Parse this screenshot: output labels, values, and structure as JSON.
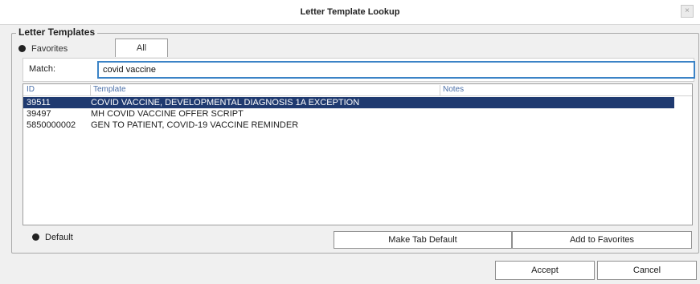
{
  "window": {
    "title": "Letter Template Lookup",
    "close_glyph": "×"
  },
  "group": {
    "legend": "Letter Templates"
  },
  "tabs": {
    "favorites_label": "Favorites",
    "all_label": "All"
  },
  "search": {
    "label": "Match:",
    "value": "covid vaccine"
  },
  "list": {
    "columns": {
      "id": "ID",
      "template": "Template",
      "notes": "Notes"
    },
    "rows": [
      {
        "id": "39511",
        "template": "COVID VACCINE, DEVELOPMENTAL DIAGNOSIS 1A EXCEPTION",
        "notes": ""
      },
      {
        "id": "39497",
        "template": "MH COVID VACCINE OFFER SCRIPT",
        "notes": ""
      },
      {
        "id": "5850000002",
        "template": "GEN TO PATIENT, COVID-19 VACCINE REMINDER",
        "notes": ""
      }
    ]
  },
  "default_label": "Default",
  "buttons": {
    "make_tab_default": "Make Tab Default",
    "add_to_favorites": "Add to Favorites",
    "accept": "Accept",
    "cancel": "Cancel"
  },
  "colors": {
    "selection": "#1f3a70",
    "focus_border": "#3b83c6",
    "header_text": "#4a6fa8"
  }
}
